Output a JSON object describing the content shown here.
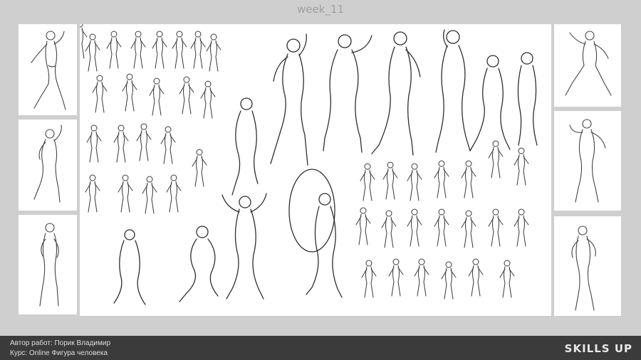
{
  "header": {
    "title": "week_11"
  },
  "footer": {
    "author_line": "Автор работ: Порик Владимир",
    "course_line": "Курс: Online Фигура человека",
    "brand": "SKILLS UP"
  },
  "style": {
    "background": "#cfcfcf",
    "panel_color": "#ffffff",
    "footer_color": "#3b3b3b",
    "stroke_color": "#3a3a3a"
  }
}
